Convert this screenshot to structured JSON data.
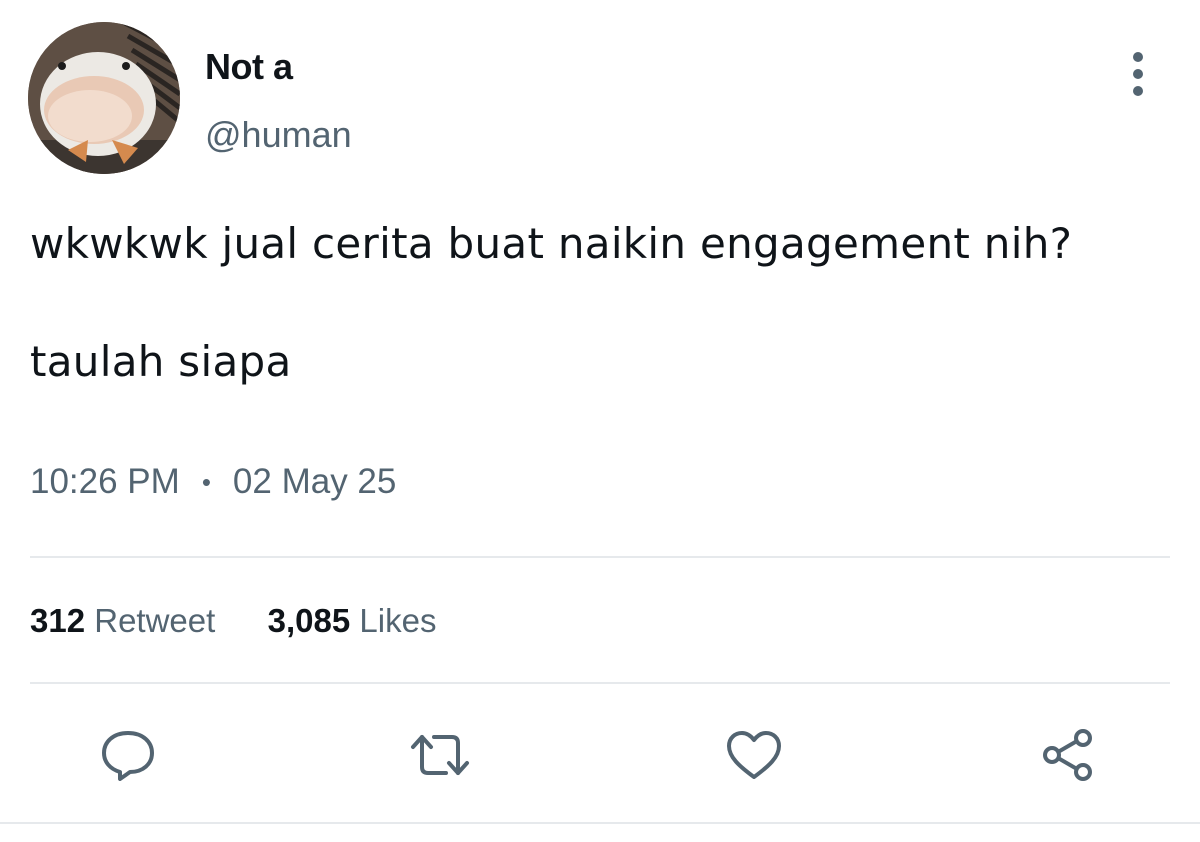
{
  "author": {
    "display_name": "Not a",
    "handle": "@human",
    "avatar_icon": "duck-avatar"
  },
  "tweet": {
    "line1": "wkwkwk jual cerita buat naikin engagement nih?",
    "line2": "taulah siapa"
  },
  "meta": {
    "time": "10:26 PM",
    "separator": "•",
    "date": "02 May 25"
  },
  "stats": {
    "retweet_count": "312",
    "retweet_label": "Retweet",
    "like_count": "3,085",
    "like_label": "Likes"
  },
  "actions": {
    "reply_icon": "reply-icon",
    "retweet_icon": "retweet-icon",
    "like_icon": "heart-icon",
    "share_icon": "share-icon"
  },
  "colors": {
    "text_primary": "#0f1419",
    "text_secondary": "#536471",
    "divider": "#e6e9ec"
  }
}
